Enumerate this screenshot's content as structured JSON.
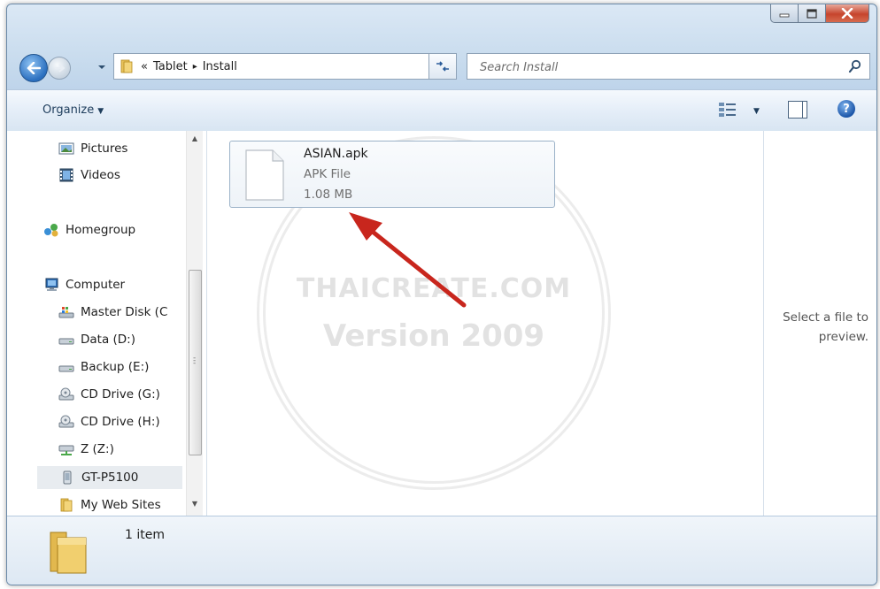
{
  "titlebar": {
    "minimize_icon": "minimize-icon",
    "maximize_icon": "maximize-icon",
    "close_icon": "close-icon"
  },
  "address": {
    "overflow": "«",
    "crumbs": [
      "Tablet",
      "Install"
    ],
    "separator": "▸"
  },
  "search": {
    "placeholder": "Search Install"
  },
  "toolbar": {
    "organize_label": "Organize"
  },
  "nav": {
    "items": [
      {
        "label": "Pictures",
        "icon": "pictures-icon"
      },
      {
        "label": "Videos",
        "icon": "videos-icon"
      },
      {
        "label": "Homegroup",
        "icon": "homegroup-icon"
      },
      {
        "label": "Computer",
        "icon": "computer-icon"
      },
      {
        "label": "Master Disk (C",
        "icon": "system-drive-icon"
      },
      {
        "label": "Data (D:)",
        "icon": "drive-icon"
      },
      {
        "label": "Backup (E:)",
        "icon": "drive-icon"
      },
      {
        "label": "CD Drive (G:)",
        "icon": "cd-drive-icon"
      },
      {
        "label": "CD Drive (H:)",
        "icon": "cd-drive-icon"
      },
      {
        "label": "Z (Z:)",
        "icon": "network-drive-icon"
      },
      {
        "label": "GT-P5100",
        "icon": "device-icon"
      },
      {
        "label": "My Web Sites",
        "icon": "folder-icon"
      }
    ],
    "selected": "GT-P5100"
  },
  "files": [
    {
      "name": "ASIAN.apk",
      "type": "APK File",
      "size": "1.08 MB"
    }
  ],
  "watermark": {
    "line1": "THAICREATE.COM",
    "line2": "Version 2009"
  },
  "preview": {
    "text_line1": "Select a file to",
    "text_line2": "preview."
  },
  "status": {
    "count": "1 item"
  },
  "colors": {
    "arrow": "#c8261d",
    "selection": "#e8ecf0",
    "chrome": "#c9dcee"
  }
}
